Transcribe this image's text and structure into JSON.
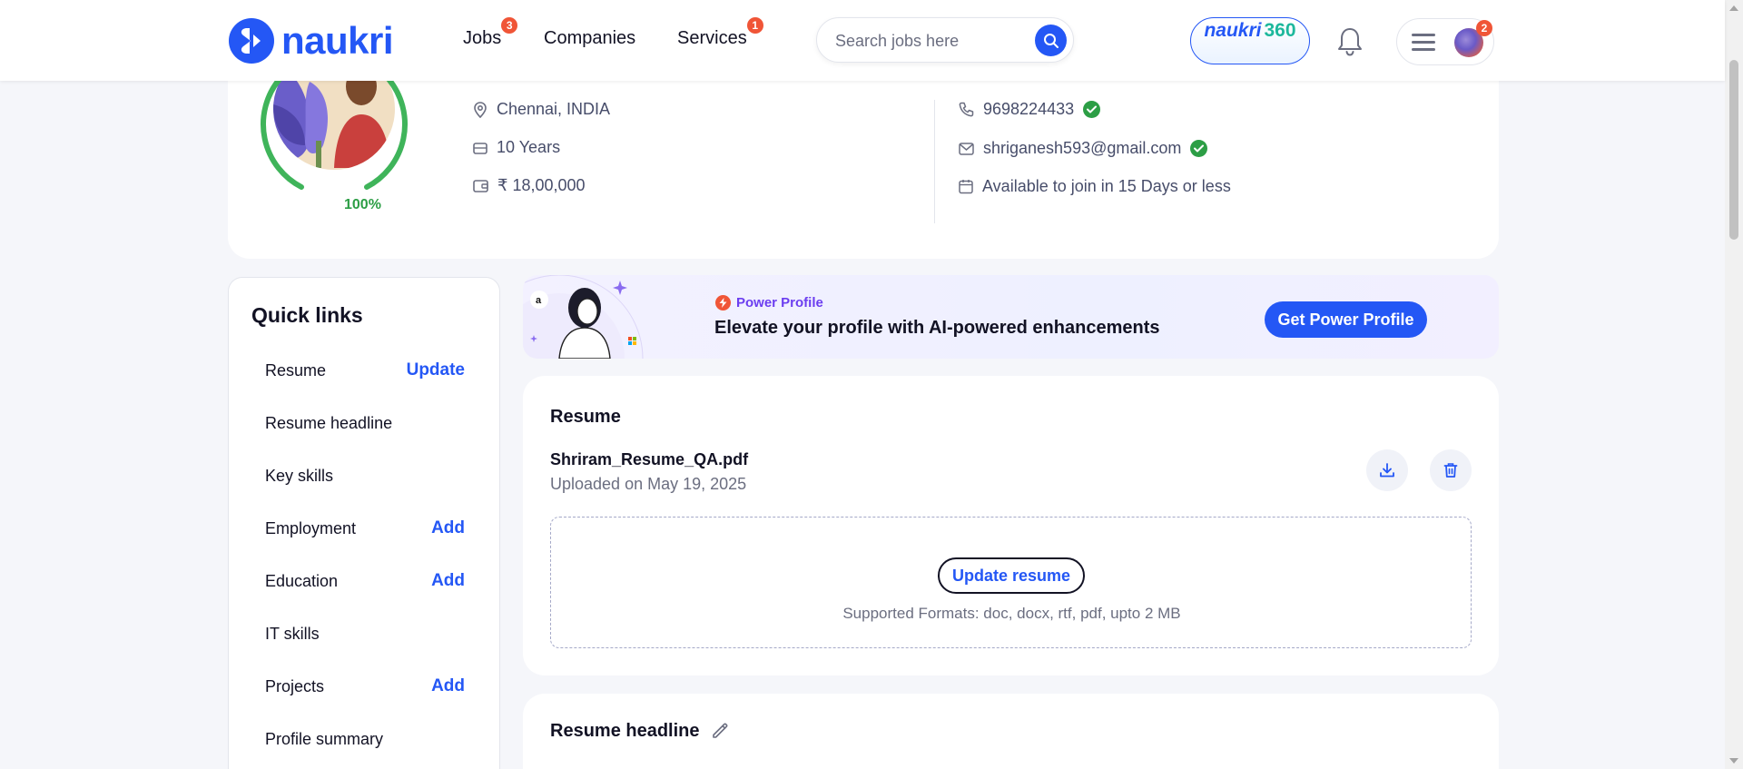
{
  "header": {
    "logo_text": "naukri",
    "nav": [
      {
        "label": "Jobs",
        "badge": "3"
      },
      {
        "label": "Companies",
        "badge": ""
      },
      {
        "label": "Services",
        "badge": "1"
      }
    ],
    "search": {
      "placeholder": "Search jobs here",
      "value": ""
    },
    "naukri360": {
      "part1": "naukri",
      "part2": "360"
    },
    "menu_badge": "2"
  },
  "profile": {
    "completion": "100%",
    "location": "Chennai, INDIA",
    "experience": "10 Years",
    "salary": "₹ 18,00,000",
    "phone": "9698224433",
    "email": "shriganesh593@gmail.com",
    "availability": "Available to join in 15 Days or less"
  },
  "quick_links": {
    "title": "Quick links",
    "items": [
      {
        "label": "Resume",
        "action": "Update"
      },
      {
        "label": "Resume headline",
        "action": ""
      },
      {
        "label": "Key skills",
        "action": ""
      },
      {
        "label": "Employment",
        "action": "Add"
      },
      {
        "label": "Education",
        "action": "Add"
      },
      {
        "label": "IT skills",
        "action": ""
      },
      {
        "label": "Projects",
        "action": "Add"
      },
      {
        "label": "Profile summary",
        "action": ""
      }
    ]
  },
  "power_profile": {
    "tag": "Power Profile",
    "title": "Elevate your profile with AI-powered enhancements",
    "button": "Get Power Profile"
  },
  "resume": {
    "title": "Resume",
    "file_name": "Shriram_Resume_QA.pdf",
    "uploaded": "Uploaded on May 19, 2025",
    "update_button": "Update resume",
    "formats": "Supported Formats: doc, docx, rtf, pdf, upto 2 MB"
  },
  "resume_headline": {
    "title": "Resume headline"
  },
  "colors": {
    "brand_blue": "#2457f5",
    "badge_red": "#f05537",
    "success_green": "#2c9e45",
    "naukri360_teal": "#1db89c"
  },
  "icons": [
    "logo-icon",
    "search-icon",
    "bell-icon",
    "hamburger-icon",
    "location-icon",
    "briefcase-icon",
    "wallet-icon",
    "phone-icon",
    "mail-icon",
    "calendar-icon",
    "verified-icon",
    "bolt-icon",
    "download-icon",
    "delete-icon",
    "edit-icon"
  ]
}
